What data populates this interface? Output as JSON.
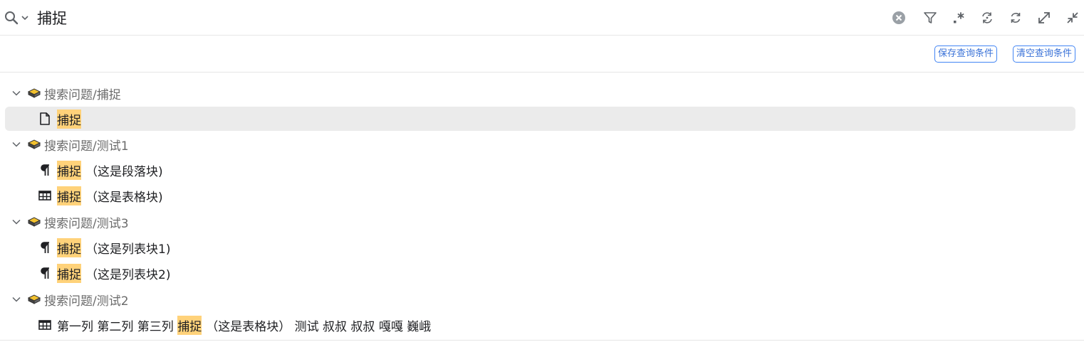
{
  "search": {
    "query": "捕捉"
  },
  "toolbar": {
    "icons": [
      "clear-icon",
      "filter-icon",
      "regex-icon",
      "replace-icon",
      "refresh-icon",
      "expand-icon",
      "collapse-icon"
    ]
  },
  "conditions": {
    "save_label": "保存查询条件",
    "clear_label": "清空查询条件"
  },
  "results": {
    "groups": [
      {
        "path": "搜索问题/捕捉",
        "items": [
          {
            "icon": "document-icon",
            "highlight": "捕捉",
            "suffix": ""
          }
        ]
      },
      {
        "path": "搜索问题/测试1",
        "items": [
          {
            "icon": "paragraph-icon",
            "highlight": "捕捉",
            "suffix": "（这是段落块)"
          },
          {
            "icon": "table-icon",
            "highlight": "捕捉",
            "suffix": "（这是表格块)"
          }
        ]
      },
      {
        "path": "搜索问题/测试3",
        "items": [
          {
            "icon": "paragraph-icon",
            "highlight": "捕捉",
            "suffix": "（这是列表块1)"
          },
          {
            "icon": "paragraph-icon",
            "highlight": "捕捉",
            "suffix": "（这是列表块2)"
          }
        ]
      },
      {
        "path": "搜索问题/测试2",
        "items": [
          {
            "icon": "table-icon",
            "prefix": "第一列 第二列 第三列 ",
            "highlight": "捕捉",
            "suffix": "（这是表格块） 测试 叔叔 叔叔 嘎嘎 巍峨"
          }
        ]
      }
    ]
  },
  "colors": {
    "highlight": "#ffd27a",
    "selected_row": "#ebebeb",
    "accent_border": "#4285f4",
    "group_text": "#6b6b6b"
  }
}
